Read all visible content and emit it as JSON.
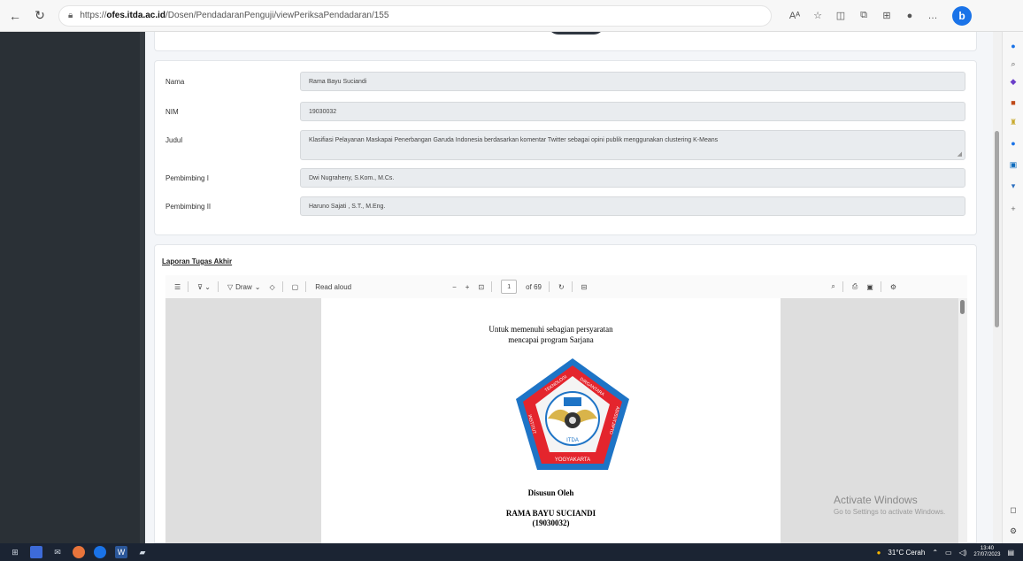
{
  "browser": {
    "url_prefix": "https://",
    "url_host": "ofes.itda.ac.id",
    "url_path": "/Dosen/PendadaranPenguji/viewPeriksaPendadaran/155",
    "read_aloud_icon": "Aᴬ",
    "icons": [
      "back-icon",
      "refresh-icon",
      "lock-icon",
      "favorite-icon",
      "split-screen-icon",
      "collections-icon",
      "extensions-icon",
      "profile-icon",
      "more-icon",
      "bing-icon"
    ]
  },
  "form": {
    "nama_label": "Nama",
    "nama_value": "Rama Bayu Suciandi",
    "nim_label": "NIM",
    "nim_value": "19030032",
    "judul_label": "Judul",
    "judul_value": "Klasifiasi Pelayanan Maskapai Penerbangan Garuda Indonesia berdasarkan komentar Twitter sebagai opini publik menggunakan clustering K-Means",
    "pembimbing1_label": "Pembimbing I",
    "pembimbing1_value": "Dwi Nugraheny, S.Kom., M.Cs.",
    "pembimbing2_label": "Pembimbing II",
    "pembimbing2_value": "Haruno Sajati , S.T., M.Eng."
  },
  "pdf": {
    "section_title": "Laporan Tugas Akhir",
    "draw_label": "Draw",
    "read_aloud_label": "Read aloud",
    "page_current": "1",
    "page_total": "of 69",
    "page": {
      "line1": "Untuk memenuhi sebagian persyaratan",
      "line2": "mencapai program Sarjana",
      "logo_top_left": "TEKNOLOGI",
      "logo_top_right": "DIRGANTARA",
      "logo_left": "INSTITUT",
      "logo_right": "ADISUTJIPTO",
      "logo_center": "ITDA",
      "logo_bottom": "YOGYAKARTA",
      "disusun": "Disusun Oleh",
      "author": "RAMA BAYU SUCIANDI",
      "author_nim": "(19030032)"
    }
  },
  "watermark": {
    "title": "Activate Windows",
    "subtitle": "Go to Settings to activate Windows."
  },
  "taskbar": {
    "weather": "31°C  Cerah",
    "time": "13:40",
    "date": "27/07/2023"
  },
  "colors": {
    "sidebar_dark": "#2a3036",
    "field_bg": "#e9ecef",
    "taskbar": "#1b2433",
    "logo_red": "#e4252d",
    "logo_blue": "#1e74c6"
  }
}
